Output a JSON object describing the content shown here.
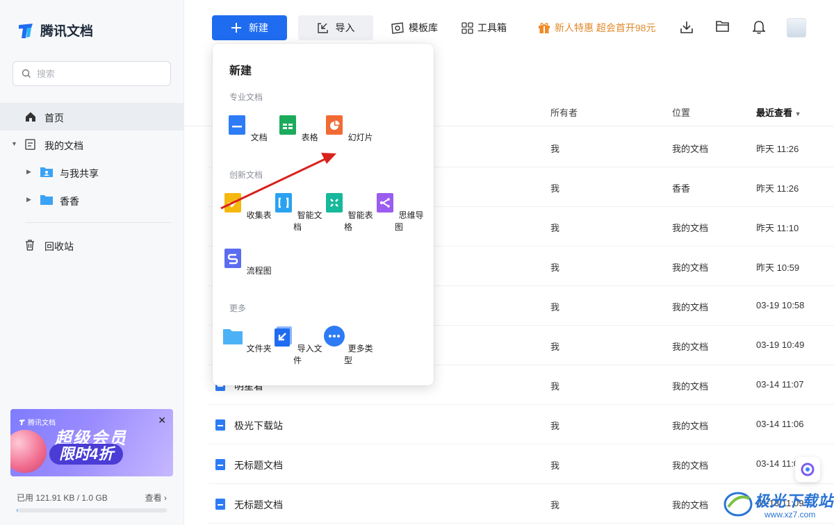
{
  "app": {
    "name": "腾讯文档"
  },
  "search": {
    "placeholder": "搜索"
  },
  "sidebar": {
    "home": "首页",
    "my_docs": "我的文档",
    "shared": "与我共享",
    "folder": "香香",
    "trash": "回收站"
  },
  "promo": {
    "brand": "腾讯文档",
    "line1": "超级会员",
    "line2": "限时4折"
  },
  "storage": {
    "used_label": "已用 121.91 KB / 1.0 GB",
    "view": "查看 ›",
    "used_fraction": 0.0001
  },
  "toolbar": {
    "new": "新建",
    "import": "导入",
    "templates": "模板库",
    "toolbox": "工具箱",
    "offer": "新人特惠 超会首开98元"
  },
  "table": {
    "headers": {
      "owner": "所有者",
      "location": "位置",
      "recent": "最近查看"
    },
    "rows": [
      {
        "name": "",
        "owner": "我",
        "location": "我的文档",
        "time": "昨天 11:26"
      },
      {
        "name": "",
        "owner": "我",
        "location": "香香",
        "time": "昨天 11:26"
      },
      {
        "name": "",
        "owner": "我",
        "location": "我的文档",
        "time": "昨天 11:10"
      },
      {
        "name": "",
        "owner": "我",
        "location": "我的文档",
        "time": "昨天 10:59"
      },
      {
        "name": "",
        "owner": "我",
        "location": "我的文档",
        "time": "03-19 10:58"
      },
      {
        "name": "",
        "owner": "我",
        "location": "我的文档",
        "time": "03-19 10:49"
      },
      {
        "name": "明星着",
        "owner": "我",
        "location": "我的文档",
        "time": "03-14 11:07"
      },
      {
        "name": "极光下载站",
        "owner": "我",
        "location": "我的文档",
        "time": "03-14 11:06"
      },
      {
        "name": "无标题文档",
        "owner": "我",
        "location": "我的文档",
        "time": "03-14 11:0"
      },
      {
        "name": "无标题文档",
        "owner": "我",
        "location": "我的文档",
        "time": "03-13 11:09"
      }
    ]
  },
  "new_menu": {
    "title": "新建",
    "sections": {
      "pro": "专业文档",
      "creative": "创新文档",
      "more": "更多"
    },
    "items": {
      "doc": "文档",
      "sheet": "表格",
      "slide": "幻灯片",
      "form": "收集表",
      "smart_doc": "智能文档",
      "smart_sheet": "智能表格",
      "mindmap": "思维导图",
      "flowchart": "流程图",
      "folder": "文件夹",
      "import_file": "导入文件",
      "more_types": "更多类型"
    }
  },
  "watermark": {
    "text": "极光下载站",
    "url": "www.xz7.com"
  },
  "colors": {
    "primary": "#1f6cf0",
    "offer": "#e28a2b",
    "arrow": "#d9221c"
  }
}
